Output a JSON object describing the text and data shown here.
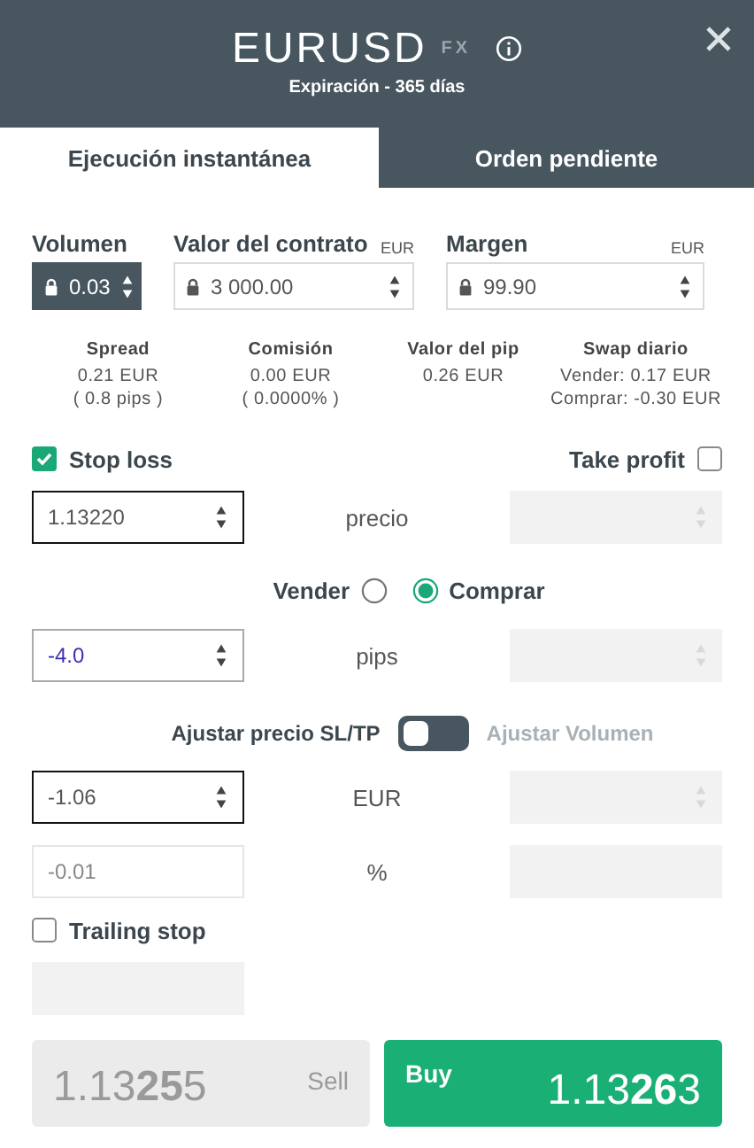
{
  "header": {
    "symbol": "EURUSD",
    "tag": "FX",
    "subtitle": "Expiración - 365 días"
  },
  "tabs": [
    {
      "label": "Ejecución instantánea",
      "selected": true
    },
    {
      "label": "Orden pendiente",
      "selected": false
    }
  ],
  "inputs": [
    {
      "label": "Volumen",
      "value": "0.03",
      "locked": true,
      "focused": true
    },
    {
      "label": "Valor del contrato",
      "unit": "EUR",
      "value": "3 000.00",
      "locked": true,
      "focused": false
    },
    {
      "label": "Margen",
      "unit": "EUR",
      "value": "99.90",
      "locked": true,
      "focused": false
    }
  ],
  "stats": [
    {
      "label": "Spread",
      "lines": [
        "0.21 EUR",
        "( 0.8 pips )"
      ]
    },
    {
      "label": "Comisión",
      "lines": [
        "0.00 EUR",
        "( 0.0000% )"
      ]
    },
    {
      "label": "Valor del pip",
      "lines": [
        "0.26 EUR"
      ]
    },
    {
      "label": "Swap diario",
      "lines": [
        "Vender: 0.17 EUR",
        "Comprar: -0.30 EUR"
      ]
    }
  ],
  "rows": [
    {
      "kind": "checks",
      "items": [
        {
          "label": "Stop loss",
          "checked": true
        },
        {
          "label": "Take profit",
          "checked": false
        }
      ]
    },
    {
      "kind": "fields",
      "label": "precio",
      "left": {
        "value": "1.13220",
        "focused": true,
        "disabled": false,
        "spinner": true
      },
      "right": {
        "disabled": true,
        "spinner": true
      }
    },
    {
      "kind": "radio",
      "options": [
        {
          "label": "Vender",
          "selected": false
        },
        {
          "label": "Comprar",
          "selected": true
        }
      ]
    },
    {
      "kind": "fields",
      "label": "pips",
      "left": {
        "value": "-4.0",
        "focused": false,
        "disabled": false,
        "spinner": true
      },
      "right": {
        "disabled": true,
        "spinner": true
      }
    },
    {
      "kind": "toggle",
      "left_label": "Ajustar precio SL/TP",
      "right_label": "Ajustar Volumen",
      "on": false
    },
    {
      "kind": "fields",
      "label": "EUR",
      "left": {
        "value": "-1.06",
        "focused": true,
        "disabled": false,
        "spinner": true
      },
      "right": {
        "disabled": true,
        "spinner": true
      }
    },
    {
      "kind": "fields",
      "label": "%",
      "left": {
        "value": "-0.01",
        "focused": false,
        "disabled": false,
        "spinner": false
      },
      "right": {
        "disabled": true,
        "spinner": false
      }
    },
    {
      "kind": "checks",
      "items": [
        {
          "label": "Trailing stop",
          "checked": false
        }
      ]
    },
    {
      "kind": "single",
      "left": {
        "disabled": true,
        "spinner": false
      }
    }
  ],
  "trade_buttons": [
    {
      "label": "Sell",
      "price": "1.13**25**5",
      "disabled": true
    },
    {
      "label": "Buy",
      "price": "1.13**26**3",
      "disabled": false
    }
  ]
}
